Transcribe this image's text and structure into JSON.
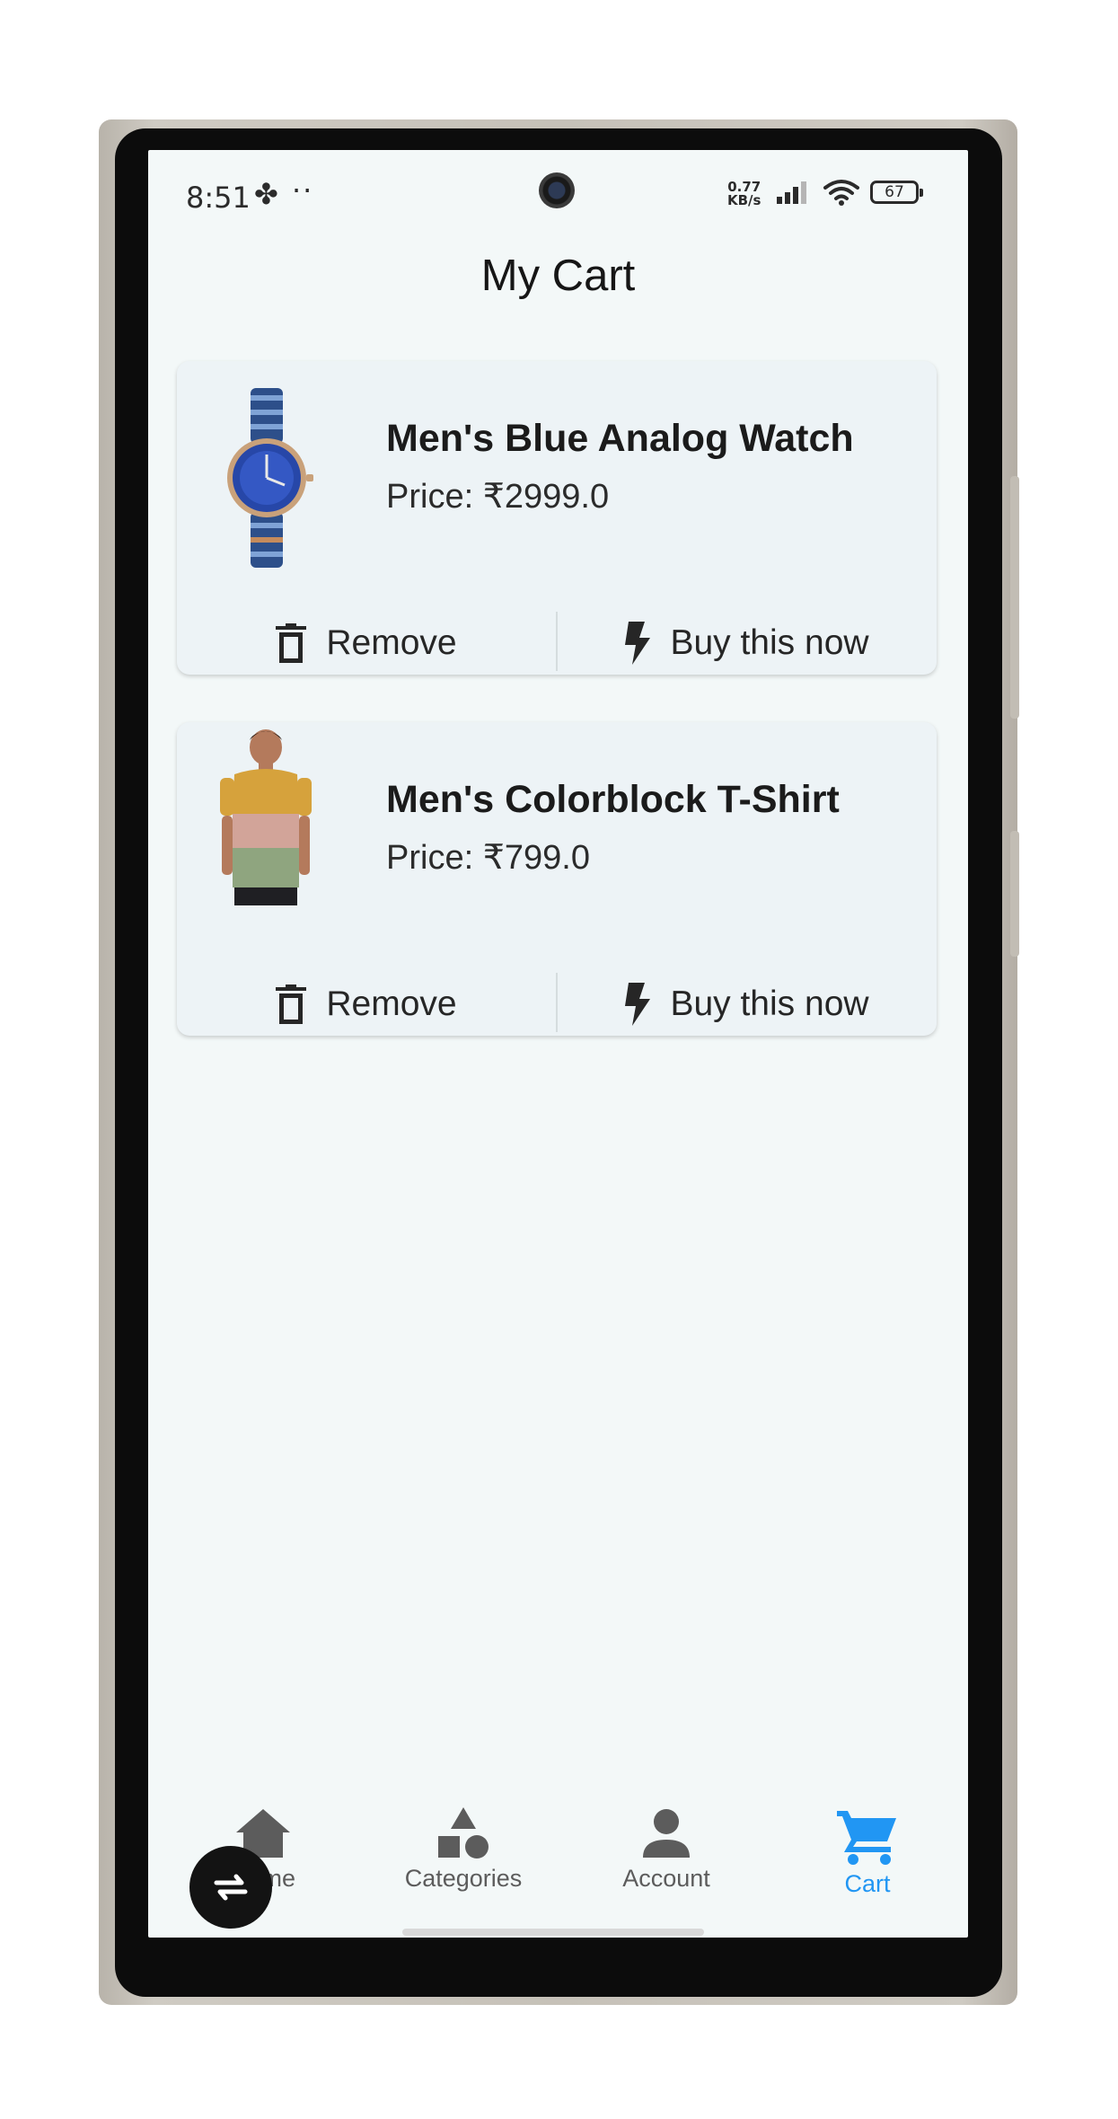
{
  "status_bar": {
    "time": "8:51",
    "dots": "··",
    "net_speed_value": "0.77",
    "net_speed_unit": "KB/s",
    "battery": "67"
  },
  "header": {
    "title": "My Cart"
  },
  "cart": {
    "items": [
      {
        "name": "Men's Blue Analog Watch",
        "price": "Price: ₹2999.0",
        "remove_label": "Remove",
        "buy_label": "Buy this now",
        "image": "watch-image"
      },
      {
        "name": "Men's Colorblock T-Shirt",
        "price": "Price: ₹799.0",
        "remove_label": "Remove",
        "buy_label": "Buy this now",
        "image": "tshirt-model-image"
      }
    ]
  },
  "bottom_nav": {
    "items": [
      {
        "label": "Home",
        "icon": "home-icon",
        "active": false
      },
      {
        "label": "Categories",
        "icon": "categories-icon",
        "active": false
      },
      {
        "label": "Account",
        "icon": "account-icon",
        "active": false
      },
      {
        "label": "Cart",
        "icon": "cart-icon",
        "active": true
      }
    ],
    "active_color": "#2196f3",
    "inactive_color": "#5c5c5c"
  }
}
